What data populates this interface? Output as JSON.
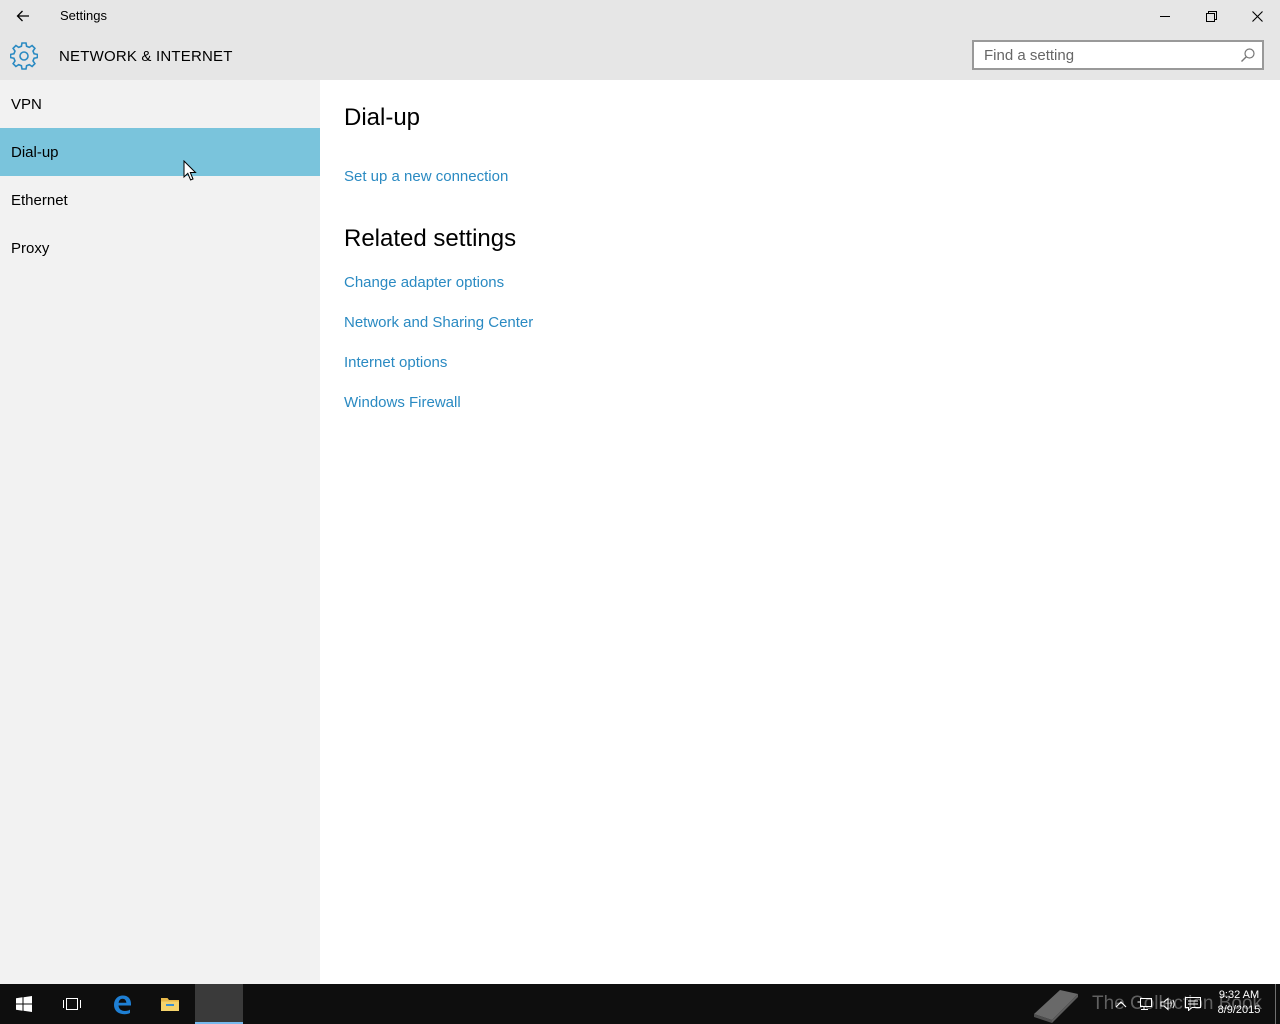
{
  "window": {
    "title": "Settings",
    "icons": {
      "back": "back-arrow-icon",
      "minimize": "minimize-icon",
      "restore": "restore-icon",
      "close": "close-icon"
    }
  },
  "header": {
    "title": "NETWORK & INTERNET",
    "icon": "gear-icon"
  },
  "search": {
    "placeholder": "Find a setting",
    "value": ""
  },
  "sidebar": {
    "items": [
      {
        "label": "VPN",
        "selected": false
      },
      {
        "label": "Dial-up",
        "selected": true
      },
      {
        "label": "Ethernet",
        "selected": false
      },
      {
        "label": "Proxy",
        "selected": false
      }
    ]
  },
  "main": {
    "title": "Dial-up",
    "setup_link": "Set up a new connection",
    "related_title": "Related settings",
    "related_links": [
      "Change adapter options",
      "Network and Sharing Center",
      "Internet options",
      "Windows Firewall"
    ]
  },
  "taskbar": {
    "watermark": "The Collection Book",
    "time": "9:32 AM",
    "date": "8/9/2015",
    "icons": [
      "start-icon",
      "task-view-icon",
      "edge-icon",
      "file-explorer-icon",
      "settings-app-icon"
    ],
    "tray_icons": [
      "chevron-up-icon",
      "network-icon",
      "volume-icon",
      "action-center-icon"
    ]
  },
  "colors": {
    "accent": "#2a8ac2",
    "selection": "#7ac4dc",
    "chrome": "#e6e6e6",
    "sidebar": "#f2f2f2",
    "taskbar": "#0e0e0e",
    "gear": "#2a8ac2"
  }
}
